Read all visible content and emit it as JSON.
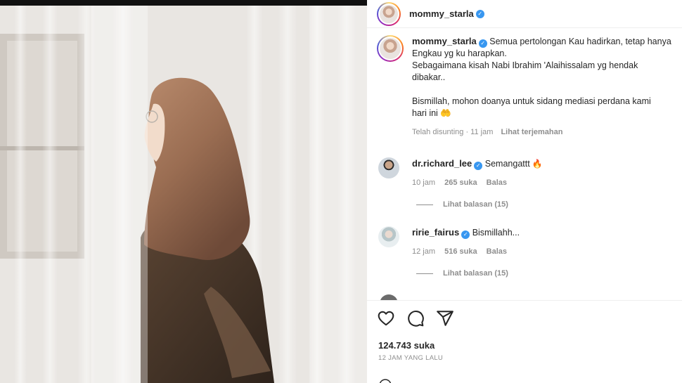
{
  "post": {
    "username": "mommy_starla",
    "caption_lines": [
      "Semua pertolongan Kau hadirkan, tetap hanya",
      "Engkau yg ku harapkan.",
      "Sebagaimana kisah Nabi Ibrahim 'Alaihissalam yg hendak",
      "dibakar..",
      "Bismillah, mohon doanya untuk sidang mediasi perdana kami",
      "hari ini 🤲"
    ],
    "edited_time": "Telah disunting · 11 jam",
    "translate_label": "Lihat terjemahan",
    "likes": "124.743 suka",
    "posted_ago": "12 JAM YANG LALU"
  },
  "comments": [
    {
      "username": "dr.richard_lee",
      "text": "Semangattt",
      "time": "10 jam",
      "likes": "265 suka",
      "reply_label": "Balas",
      "view_replies": "Lihat balasan (15)"
    },
    {
      "username": "ririe_fairus",
      "text": "Bismillahh...",
      "time": "12 jam",
      "likes": "516 suka",
      "reply_label": "Balas",
      "view_replies": "Lihat balasan (15)"
    }
  ],
  "icons": {
    "verified": "✓",
    "fire": "🔥",
    "like": "heart-icon",
    "comment": "comment-icon",
    "share": "share-icon"
  },
  "colors": {
    "verified_blue": "#3897f0",
    "muted_text": "#8e8e8e"
  }
}
